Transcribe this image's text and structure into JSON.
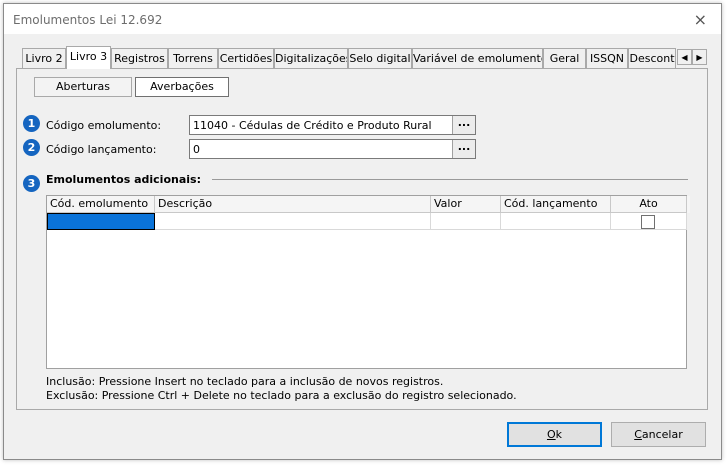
{
  "window": {
    "title": "Emolumentos Lei 12.692",
    "close_icon": "×"
  },
  "tabs": [
    {
      "label": "Livro 2",
      "active": false
    },
    {
      "label": "Livro 3",
      "active": true
    },
    {
      "label": "Registros",
      "active": false
    },
    {
      "label": "Torrens",
      "active": false
    },
    {
      "label": "Certidões",
      "active": false
    },
    {
      "label": "Digitalizações",
      "active": false
    },
    {
      "label": "Selo digital",
      "active": false
    },
    {
      "label": "Variável de emolumentos",
      "active": false
    },
    {
      "label": "Geral",
      "active": false
    },
    {
      "label": "ISSQN",
      "active": false
    },
    {
      "label": "Descont",
      "active": false
    }
  ],
  "tab_scroll": {
    "left": "◀",
    "right": "▶"
  },
  "subtabs": [
    {
      "label": "Aberturas",
      "active": false
    },
    {
      "label": "Averbações",
      "active": true
    }
  ],
  "form": {
    "badge1": "1",
    "badge2": "2",
    "badge3": "3",
    "codigo_emolumento_label": "Código emolumento:",
    "codigo_emolumento_value": "11040 - Cédulas de Crédito e Produto Rural",
    "codigo_lancamento_label": "Código lançamento:",
    "codigo_lancamento_value": "0",
    "browse_label": "...",
    "section_title": "Emolumentos adicionais:"
  },
  "grid": {
    "columns": [
      "Cód. emolumento",
      "Descrição",
      "Valor",
      "Cód. lançamento",
      "Ato"
    ],
    "rows": [
      {
        "cod": "",
        "descricao": "",
        "valor": "",
        "lancamento": "",
        "ato": false
      }
    ]
  },
  "notes": {
    "inclusao": "Inclusão: Pressione Insert no teclado para a inclusão de novos registros.",
    "exclusao": "Exclusão: Pressione Ctrl + Delete no teclado para a exclusão do registro selecionado."
  },
  "buttons": {
    "ok_u": "O",
    "ok_rest": "k",
    "cancel_u": "C",
    "cancel_rest": "ancelar"
  }
}
